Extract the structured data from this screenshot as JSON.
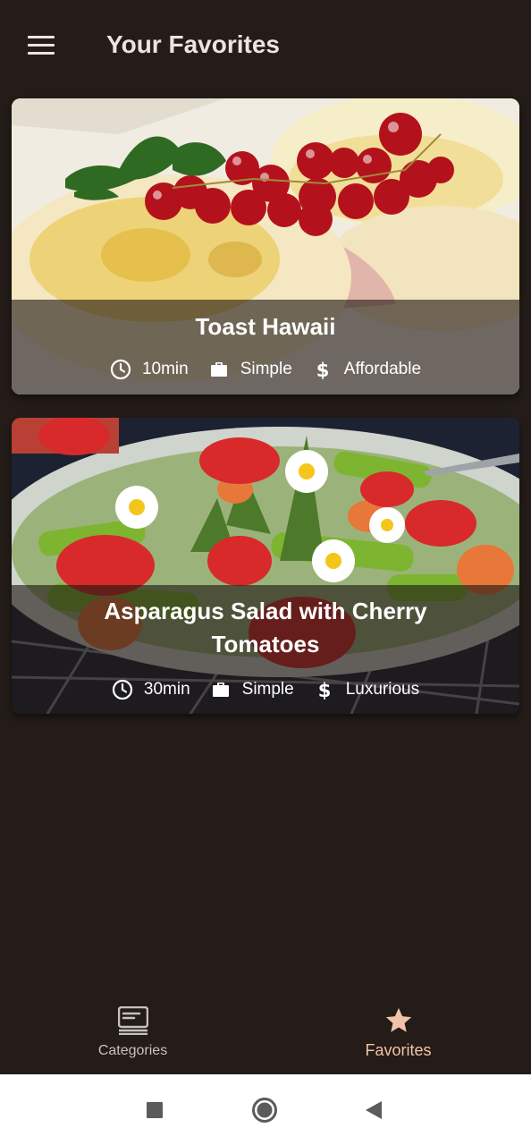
{
  "header": {
    "title": "Your Favorites",
    "menu_icon": "hamburger-menu-icon"
  },
  "meals": [
    {
      "title": "Toast Hawaii",
      "duration": "10min",
      "complexity": "Simple",
      "affordability": "Affordable"
    },
    {
      "title": "Asparagus Salad with Cherry Tomatoes",
      "duration": "30min",
      "complexity": "Simple",
      "affordability": "Luxurious"
    }
  ],
  "bottom_nav": {
    "items": [
      {
        "label": "Categories",
        "icon": "categories-icon",
        "selected": false
      },
      {
        "label": "Favorites",
        "icon": "star-icon",
        "selected": true
      }
    ]
  },
  "system_nav": {
    "recents_icon": "square-recents-icon",
    "home_icon": "circle-home-icon",
    "back_icon": "triangle-back-icon"
  },
  "colors": {
    "background": "#231c18",
    "accent": "#f2c3a8",
    "text": "#ece4de"
  }
}
